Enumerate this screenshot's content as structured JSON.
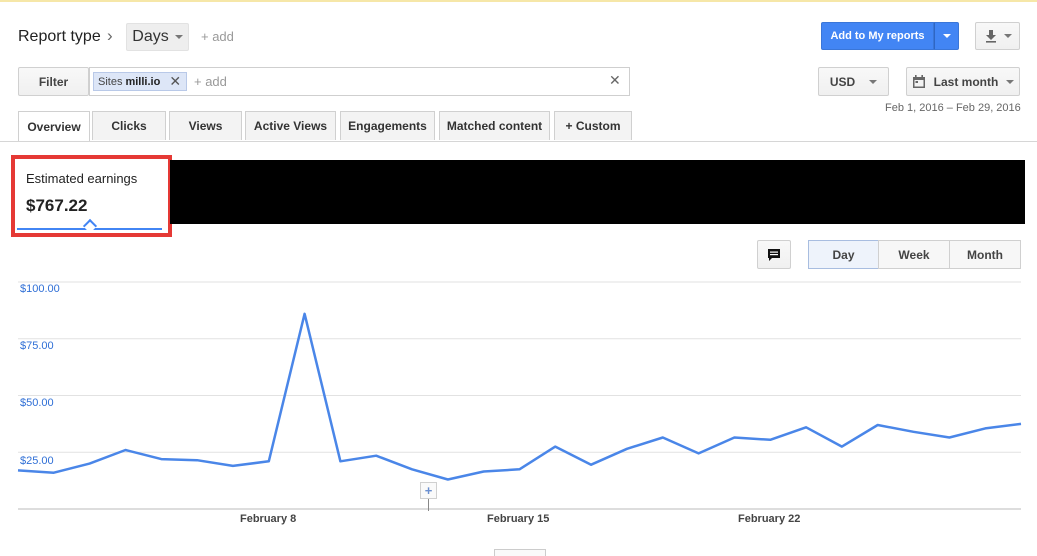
{
  "header": {
    "report_type_label": "Report type",
    "breadcrumb_sep": "›",
    "days_label": "Days",
    "add_label": "+ add",
    "add_reports_label": "Add to My reports"
  },
  "filter": {
    "filter_label": "Filter",
    "chip_prefix": "Sites",
    "chip_value": "milli.io",
    "add_placeholder": "+ add"
  },
  "controls": {
    "currency": "USD",
    "date_range_label": "Last month",
    "date_range_text": "Feb 1, 2016 – Feb 29, 2016"
  },
  "tabs": [
    {
      "label": "Overview"
    },
    {
      "label": "Clicks"
    },
    {
      "label": "Views"
    },
    {
      "label": "Active Views"
    },
    {
      "label": "Engagements"
    },
    {
      "label": "Matched content"
    },
    {
      "label": "+  Custom"
    }
  ],
  "metric": {
    "label": "Estimated earnings",
    "value": "$767.22"
  },
  "granularity": [
    {
      "label": "Day"
    },
    {
      "label": "Week"
    },
    {
      "label": "Month"
    }
  ],
  "colors": {
    "accent": "#4285f4",
    "line": "#4a86e8",
    "highlight_box": "#e53935",
    "redaction": "#000000"
  },
  "chart_data": {
    "type": "line",
    "x": [
      "2016-02-01",
      "2016-02-02",
      "2016-02-03",
      "2016-02-04",
      "2016-02-05",
      "2016-02-06",
      "2016-02-07",
      "2016-02-08",
      "2016-02-09",
      "2016-02-10",
      "2016-02-11",
      "2016-02-12",
      "2016-02-13",
      "2016-02-14",
      "2016-02-15",
      "2016-02-16",
      "2016-02-17",
      "2016-02-18",
      "2016-02-19",
      "2016-02-20",
      "2016-02-21",
      "2016-02-22",
      "2016-02-23",
      "2016-02-24",
      "2016-02-25",
      "2016-02-26",
      "2016-02-27",
      "2016-02-28",
      "2016-02-29"
    ],
    "series": [
      {
        "values": [
          17,
          16,
          20,
          26,
          22,
          21.5,
          19,
          21,
          86,
          21,
          23.5,
          17.5,
          13,
          16.5,
          17.5,
          27.5,
          19.5,
          26.5,
          31.5,
          24.5,
          31.5,
          30.5,
          36,
          27.5,
          37,
          34,
          31.5,
          35.5,
          37.5
        ]
      }
    ],
    "ylim": [
      0,
      100
    ],
    "y_ticks": [
      "$25.00",
      "$50.00",
      "$75.00",
      "$100.00"
    ],
    "x_ticks": [
      "February 8",
      "February 15",
      "February 22"
    ],
    "grid": true
  }
}
